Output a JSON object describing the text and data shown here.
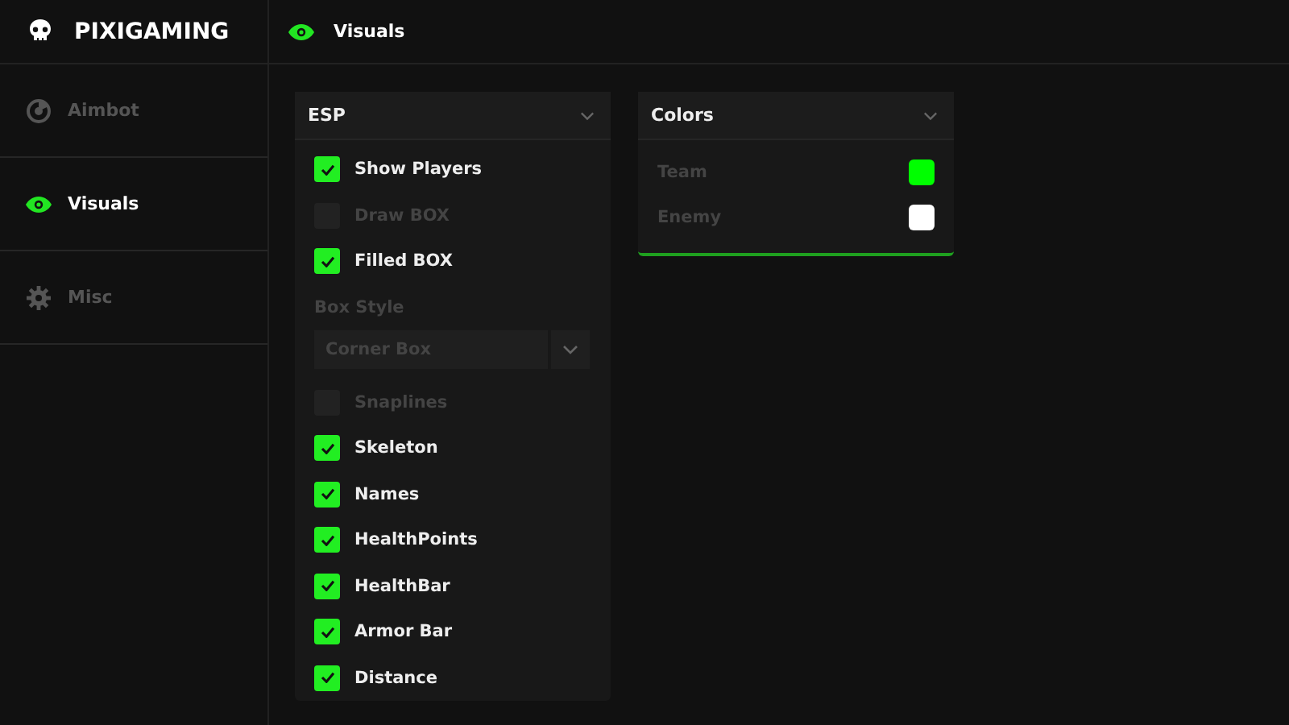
{
  "brand": "PIXIGAMING",
  "header": {
    "title": "Visuals"
  },
  "sidebar": {
    "items": [
      {
        "label": "Aimbot",
        "selected": false
      },
      {
        "label": "Visuals",
        "selected": true
      },
      {
        "label": "Misc",
        "selected": false
      }
    ]
  },
  "esp_panel": {
    "title": "ESP",
    "items": [
      {
        "kind": "checkbox",
        "label": "Show Players",
        "checked": true
      },
      {
        "kind": "checkbox",
        "label": "Draw BOX",
        "checked": false
      },
      {
        "kind": "checkbox",
        "label": "Filled BOX",
        "checked": true
      },
      {
        "kind": "label",
        "label": "Box Style"
      },
      {
        "kind": "select",
        "value": "Corner Box"
      },
      {
        "kind": "checkbox",
        "label": "Snaplines",
        "checked": false
      },
      {
        "kind": "checkbox",
        "label": "Skeleton",
        "checked": true
      },
      {
        "kind": "checkbox",
        "label": "Names",
        "checked": true
      },
      {
        "kind": "checkbox",
        "label": "HealthPoints",
        "checked": true
      },
      {
        "kind": "checkbox",
        "label": "HealthBar",
        "checked": true
      },
      {
        "kind": "checkbox",
        "label": "Armor Bar",
        "checked": true
      },
      {
        "kind": "checkbox",
        "label": "Distance",
        "checked": true
      }
    ]
  },
  "colors_panel": {
    "title": "Colors",
    "items": [
      {
        "label": "Team",
        "color": "#00ff00"
      },
      {
        "label": "Enemy",
        "color": "#ffffff"
      }
    ]
  }
}
